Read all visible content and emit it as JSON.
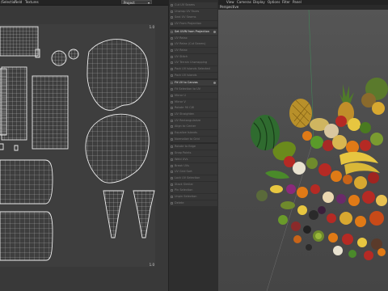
{
  "uv_editor": {
    "menu": [
      "/Selection",
      "Field",
      "Textures"
    ],
    "project_select": "Project",
    "corner_labels": {
      "top_right": "1.0",
      "bottom_right": "1.0"
    }
  },
  "menu_panel": {
    "items": [
      {
        "label": "Cut UV Seams",
        "active": false
      },
      {
        "label": "Unwrap UV Faces",
        "active": false
      },
      {
        "label": "Seal UV Seams",
        "active": false
      },
      {
        "label": "UV From Projection",
        "active": false
      },
      {
        "label": "Set UVW from Projection",
        "active": true
      },
      {
        "label": "UV Relax",
        "active": false
      },
      {
        "label": "UV Relax (Cut Seams)",
        "active": false
      },
      {
        "label": "UV Relax",
        "active": false
      },
      {
        "label": "UV Stitch",
        "active": false
      },
      {
        "label": "UV Terrain Unwrapping",
        "active": false
      },
      {
        "label": "Pack UV Islands Selected",
        "active": false
      },
      {
        "label": "Pack UV Islands",
        "active": false
      },
      {
        "label": "Fit UV to Canvas",
        "active": true
      },
      {
        "label": "Fit Selection to UV",
        "active": false
      },
      {
        "label": "Mirror U",
        "active": false
      },
      {
        "label": "Mirror V",
        "active": false
      },
      {
        "label": "Rotate 90 CW",
        "active": false
      },
      {
        "label": "UV Straighten",
        "active": false
      },
      {
        "label": "UV Rectangularize",
        "active": false
      },
      {
        "label": "Align to Center",
        "active": false
      },
      {
        "label": "Equalize Islands",
        "active": false
      },
      {
        "label": "Normalize to Grid",
        "active": false
      },
      {
        "label": "Rotate to Edge",
        "active": false
      },
      {
        "label": "Snap Points",
        "active": false
      },
      {
        "label": "Weld UVs",
        "active": false
      },
      {
        "label": "Break UVs",
        "active": false
      },
      {
        "label": "UV Grid Sort",
        "active": false
      },
      {
        "label": "Lock UV Selection",
        "active": false
      },
      {
        "label": "Stack Similar",
        "active": false
      },
      {
        "label": "Pin Selection",
        "active": false
      },
      {
        "label": "Unpin Selection",
        "active": false
      },
      {
        "label": "Delete",
        "active": false
      }
    ]
  },
  "viewport": {
    "menu": [
      "View",
      "Cameras",
      "Display",
      "Options",
      "Filter",
      "Panel"
    ],
    "camera_label": "Perspective"
  },
  "colors": {
    "accent": "#e8e8e8",
    "wireframe": "#e6e6e6",
    "watermelon": "#2f6b2f",
    "pineapple": "#b8902a",
    "apple_red": "#b52a24",
    "orange": "#e07a16",
    "banana": "#e7c640",
    "kiwi": "#6f8a2c"
  }
}
